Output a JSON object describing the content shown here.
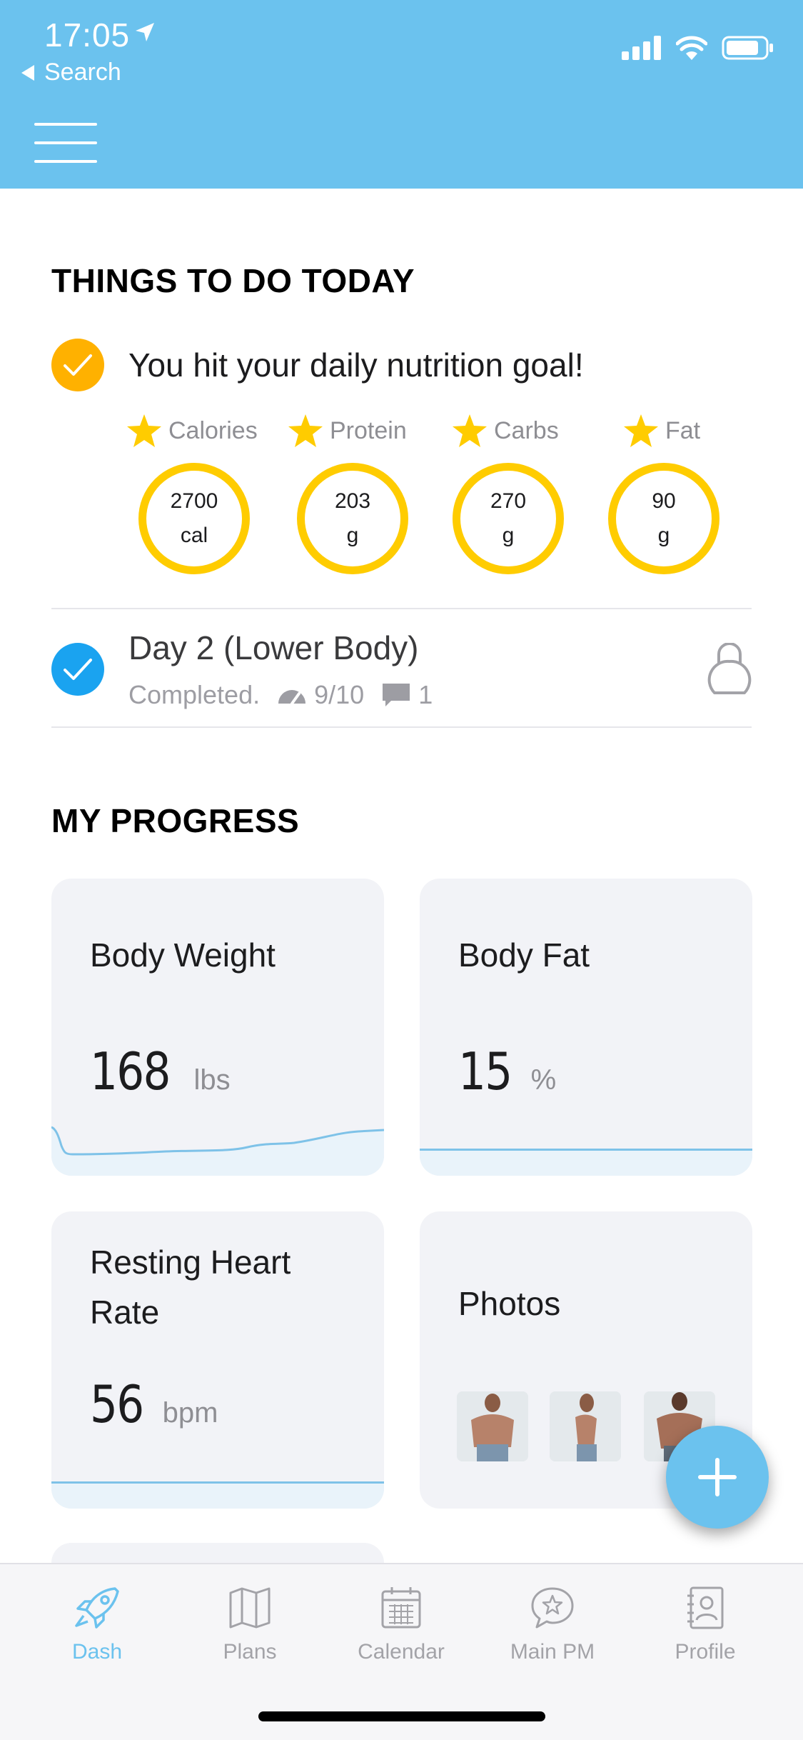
{
  "status_bar": {
    "time": "17:05",
    "back_label": "Search"
  },
  "colors": {
    "header": "#6bc2ee",
    "gold": "#ffcc00",
    "done_orange": "#ffb100",
    "done_blue": "#1aa3f0",
    "accent": "#6bc2ee"
  },
  "things_to_do": {
    "title": "THINGS TO DO TODAY",
    "nutrition_message": "You hit your daily nutrition goal!",
    "macros": [
      {
        "label": "Calories",
        "value": "2700",
        "unit": "cal"
      },
      {
        "label": "Protein",
        "value": "203",
        "unit": "g"
      },
      {
        "label": "Carbs",
        "value": "270",
        "unit": "g"
      },
      {
        "label": "Fat",
        "value": "90",
        "unit": "g"
      }
    ],
    "workout": {
      "title": "Day 2 (Lower Body)",
      "status": "Completed.",
      "rating": "9/10",
      "comments": "1"
    }
  },
  "progress": {
    "title": "MY PROGRESS",
    "cards": [
      {
        "title": "Body Weight",
        "value": "168",
        "unit": "lbs"
      },
      {
        "title": "Body Fat",
        "value": "15",
        "unit": "%"
      },
      {
        "title": "Resting Heart Rate",
        "value": "56",
        "unit": "bpm"
      },
      {
        "title": "Photos"
      }
    ]
  },
  "tabs": [
    {
      "label": "Dash",
      "icon": "rocket-icon",
      "active": true
    },
    {
      "label": "Plans",
      "icon": "map-icon",
      "active": false
    },
    {
      "label": "Calendar",
      "icon": "calendar-icon",
      "active": false
    },
    {
      "label": "Main PM",
      "icon": "chat-star-icon",
      "active": false
    },
    {
      "label": "Profile",
      "icon": "contact-book-icon",
      "active": false
    }
  ]
}
